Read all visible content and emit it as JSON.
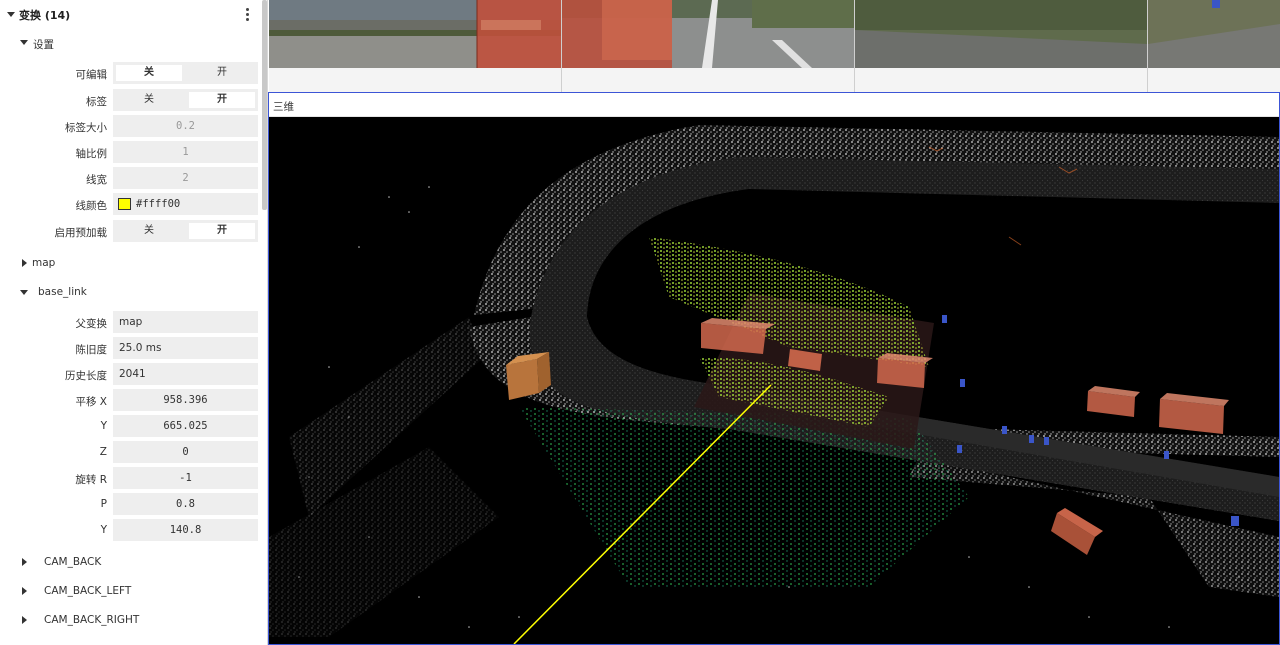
{
  "panel": {
    "title": "变换 (14)",
    "settings_label": "设置",
    "settings": {
      "editable": {
        "label": "可编辑",
        "off": "关",
        "on": "开",
        "selected": "off"
      },
      "labels": {
        "label": "标签",
        "off": "关",
        "on": "开",
        "selected": "on"
      },
      "label_size": {
        "label": "标签大小",
        "value": "0.2"
      },
      "axis_scale": {
        "label": "轴比例",
        "value": "1"
      },
      "line_width": {
        "label": "线宽",
        "value": "2"
      },
      "line_color": {
        "label": "线颜色",
        "value": "#ffff00",
        "swatch": "#ffff00"
      },
      "preload": {
        "label": "启用预加载",
        "off": "关",
        "on": "开",
        "selected": "on"
      }
    },
    "nodes": {
      "map": {
        "label": "map"
      },
      "base_link": {
        "label": "base_link",
        "parent": {
          "label": "父变换",
          "value": "map"
        },
        "age": {
          "label": "陈旧度",
          "value": "25.0 ms"
        },
        "history": {
          "label": "历史长度",
          "value": "2041"
        },
        "translation": {
          "label": "平移 X",
          "x": "958.396",
          "y_label": "Y",
          "y": "665.025",
          "z_label": "Z",
          "z": "0"
        },
        "rotation": {
          "label": "旋转 R",
          "r": "-1",
          "p_label": "P",
          "p": "0.8",
          "y_label": "Y",
          "y": "140.8"
        }
      },
      "cam_back": {
        "label": "CAM_BACK"
      },
      "cam_back_left": {
        "label": "CAM_BACK_LEFT"
      },
      "cam_back_right": {
        "label": "CAM_BACK_RIGHT"
      }
    }
  },
  "view3d": {
    "title": "三维"
  },
  "colors": {
    "accent_border": "#3c55d6",
    "toggle_bg": "#eeeeee",
    "box_orange": "#d2694d",
    "lidar_green": "#7cf04a",
    "axis_line": "#ffff00"
  }
}
